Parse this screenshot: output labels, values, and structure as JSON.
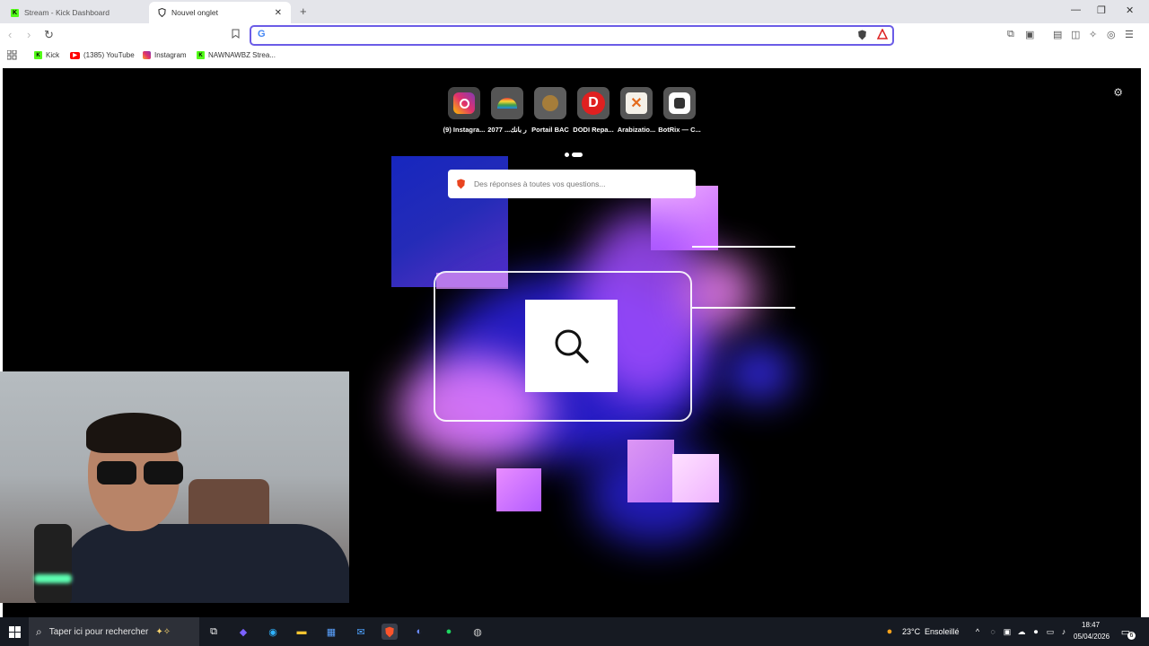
{
  "tabs": [
    {
      "title": "Stream - Kick Dashboard",
      "active": false
    },
    {
      "title": "Nouvel onglet",
      "active": true
    }
  ],
  "toolbar": {
    "url_value": "",
    "search_engine_icon": "google-icon"
  },
  "bookmarks": [
    {
      "label": "Kick"
    },
    {
      "label": "(1385) YouTube"
    },
    {
      "label": "Instagram"
    },
    {
      "label": "NAWNAWBZ Strea..."
    }
  ],
  "top_sites": [
    {
      "label": "(9) Instagra..."
    },
    {
      "label": "2077 ...ر بانك"
    },
    {
      "label": "Portail BAC"
    },
    {
      "label": "DODI Repa..."
    },
    {
      "label": "Arabizatio..."
    },
    {
      "label": "BotRix — C..."
    }
  ],
  "ask": {
    "placeholder": "Des réponses à toutes vos questions..."
  },
  "taskbar": {
    "search_placeholder": "Taper ici pour rechercher",
    "weather_temp": "23°C",
    "weather_desc": "Ensoleillé",
    "time": "18:47",
    "date": "05/04/2026",
    "notifications": "6"
  },
  "colors": {
    "accent": "#6b5ce7",
    "brave": "#fb542b",
    "kick": "#53fc18"
  }
}
